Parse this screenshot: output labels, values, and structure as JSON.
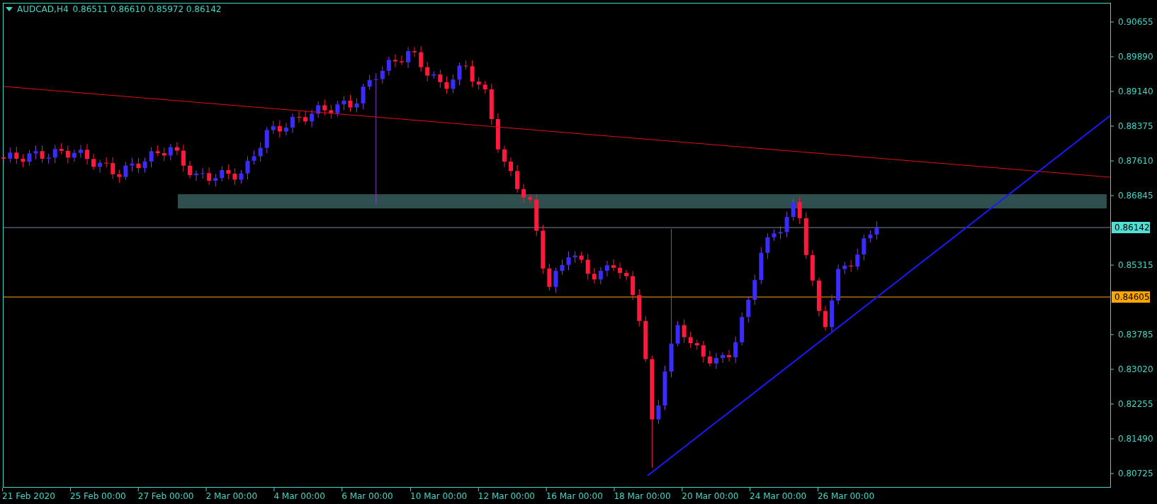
{
  "header": {
    "symbol": "AUDCAD,H4",
    "ohlc": "0.86511 0.86610 0.85972 0.86142"
  },
  "price_axis": {
    "ticks": [
      "0.90655",
      "0.89890",
      "0.89140",
      "0.88375",
      "0.87610",
      "0.86845",
      "0.85315",
      "0.83785",
      "0.83020",
      "0.82255",
      "0.81490",
      "0.80725"
    ]
  },
  "price_labels": [
    {
      "text": "0.86142",
      "kind": "bid"
    },
    {
      "text": "0.84605",
      "kind": "level"
    }
  ],
  "time_axis": {
    "ticks": [
      "21 Feb 2020",
      "25 Feb 00:00",
      "27 Feb 00:00",
      "2 Mar 00:00",
      "4 Mar 00:00",
      "6 Mar 00:00",
      "10 Mar 00:00",
      "12 Mar 00:00",
      "16 Mar 00:00",
      "18 Mar 00:00",
      "20 Mar 00:00",
      "24 Mar 00:00",
      "26 Mar 00:00"
    ]
  }
}
